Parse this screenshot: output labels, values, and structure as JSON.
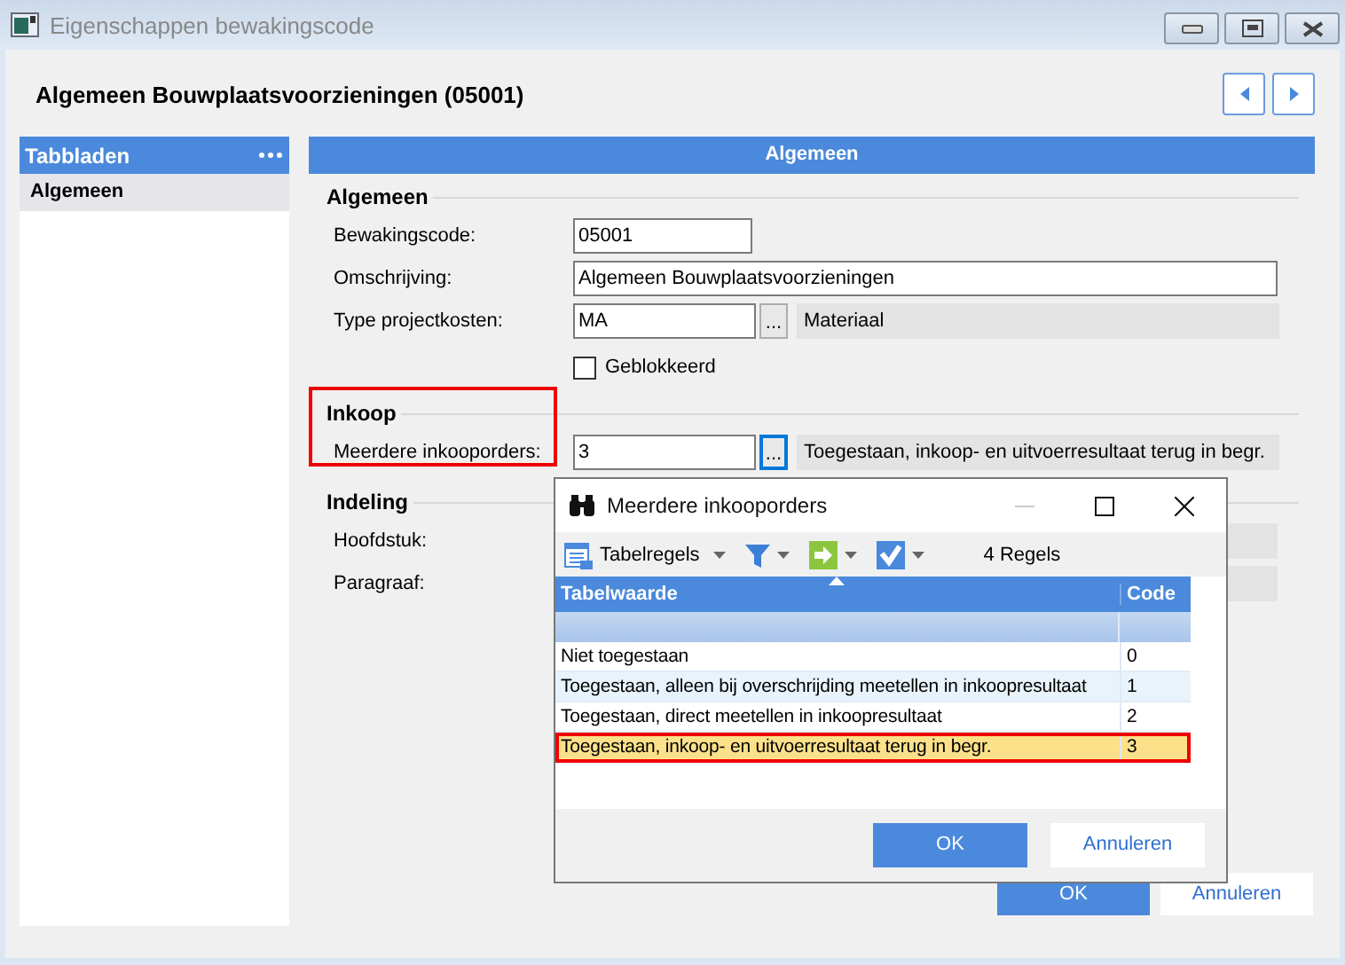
{
  "window": {
    "title": "Eigenschappen bewakingscode"
  },
  "heading": "Algemeen Bouwplaatsvoorzieningen (05001)",
  "sidebar": {
    "title": "Tabbladen",
    "items": [
      {
        "label": "Algemeen",
        "selected": true
      }
    ]
  },
  "panel": {
    "title": "Algemeen",
    "sections": [
      {
        "title": "Algemeen",
        "highlighted": false,
        "fields": [
          {
            "kind": "code",
            "label": "Bewakingscode:",
            "value": "05001"
          },
          {
            "kind": "text",
            "label": "Omschrijving:",
            "value": "Algemeen Bouwplaatsvoorzieningen"
          },
          {
            "kind": "lookup",
            "label": "Type projectkosten:",
            "value": "MA",
            "button": "...",
            "description": "Materiaal",
            "focused": false
          },
          {
            "kind": "checkbox",
            "label": "Geblokkeerd",
            "checked": false
          }
        ]
      },
      {
        "title": "Inkoop",
        "highlighted": true,
        "fields": [
          {
            "kind": "lookup",
            "label": "Meerdere inkooporders:",
            "value": "3",
            "button": "...",
            "description": "Toegestaan, inkoop- en uitvoerresultaat terug in begr.",
            "focused": true
          }
        ]
      },
      {
        "title": "Indeling",
        "highlighted": false,
        "fields": [
          {
            "kind": "covered",
            "label": "Hoofdstuk:"
          },
          {
            "kind": "covered",
            "label": "Paragraaf:"
          }
        ]
      }
    ]
  },
  "dialog": {
    "title": "Meerdere inkooporders",
    "toolbar": {
      "table_button": "Tabelregels",
      "count": "4 Regels"
    },
    "columns": [
      "Tabelwaarde",
      "Code"
    ],
    "rows": [
      {
        "value": "Niet toegestaan",
        "code": "0",
        "selected": false,
        "highlighted": false
      },
      {
        "value": "Toegestaan, alleen bij overschrijding meetellen in inkoopresultaat",
        "code": "1",
        "selected": false,
        "highlighted": false
      },
      {
        "value": "Toegestaan, direct meetellen in inkoopresultaat",
        "code": "2",
        "selected": false,
        "highlighted": false
      },
      {
        "value": "Toegestaan, inkoop- en uitvoerresultaat terug in begr.",
        "code": "3",
        "selected": true,
        "highlighted": true
      }
    ],
    "buttons": [
      {
        "label": "OK",
        "primary": true
      },
      {
        "label": "Annuleren",
        "primary": false
      }
    ]
  },
  "buttons": [
    {
      "label": "OK",
      "primary": true
    },
    {
      "label": "Annuleren",
      "primary": false
    }
  ]
}
